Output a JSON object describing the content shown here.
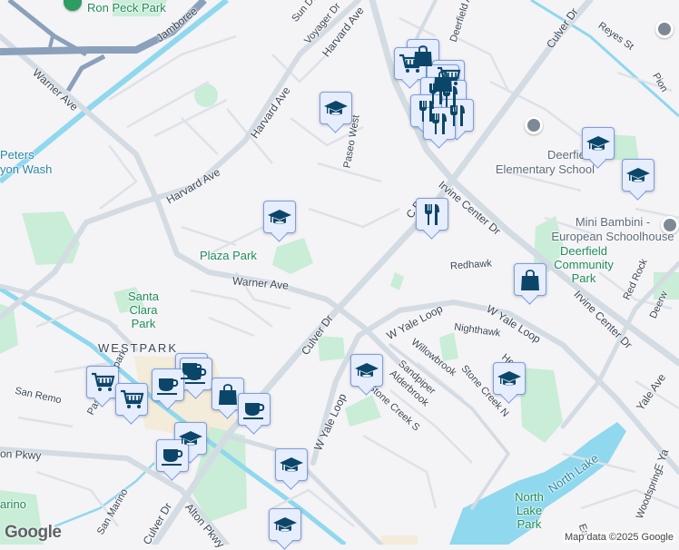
{
  "map": {
    "labels": {
      "ron_peck_park": "Ron Peck Park",
      "jamboree": "Jamboree",
      "sun_di": "Sun Di",
      "voyager_dr": "Voyager Dr",
      "harvard_ave_1": "Harvard Ave",
      "harvard_ave_2": "Harvard Ave",
      "harvard_ave_3": "Harvard Ave",
      "warner_ave_1": "Warner Ave",
      "warner_ave_2": "Warner Ave",
      "peters_canyon_wash_1": "Peters",
      "peters_canyon_wash_2": "yon Wash",
      "plaza_park": "Plaza Park",
      "paseo_west": "Paseo West",
      "deerfield_ave": "Deerfield Av",
      "culver_dr_1": "Culver Dr",
      "culver_dr_2": "C     Dr",
      "culver_dr_3": "Culver Dr",
      "culver_dr_4": "Culver Dr",
      "reyes_st": "Reyes St",
      "pion": "Pion",
      "deerfield_elementary": "Deerfield Elementary School",
      "irvine_center_dr_1": "Irvine Center Dr",
      "irvine_center_dr_2": "Irvine Center Dr",
      "mini_bambini": "Mini Bambini - European Schoolhouse",
      "deerfield_community_park": "Deerfield Community Park",
      "redhawk": "Redhawk",
      "red_rock": "Red Rock",
      "deerw": "Deerw",
      "santa_clara_park": "Santa Clara Park",
      "westpark": "WESTPARK",
      "san_remo": "San Remo",
      "paseo_westpark": "Paseo Westpark",
      "w_yale_loop_1": "W Yale Loop",
      "w_yale_loop_2": "W Yale Loop",
      "w_yale_loop_3": "W Yale Loop",
      "nighthawk": "Nighthawk",
      "willowbrook": "Willowbrook",
      "sandpiper": "Sandpiper",
      "alderbrook": "Alderbrook",
      "stone_creek_s": "Stone Creek S",
      "stone_creek_n": "Stone Creek N",
      "her": "Her",
      "yale_ave": "Yale Ave",
      "e_ya": "E Ya",
      "woodspring": "Woodspring",
      "north_lake": "North Lake",
      "north_lake_park": "North Lake Park",
      "san_marino_1": "San Marino",
      "san_marino_2": "arino",
      "alton_pkwy_1": "on Pkwy",
      "alton_pkwy_2": "Alton Pkwy",
      "ea": "Ea"
    },
    "attribution": "Map data ©2025 Google",
    "logo": "Google",
    "colors": {
      "background": "#f4f3f5",
      "road": "#d3dbe3",
      "freeway": "#8aa0bb",
      "water": "#8fd8ee",
      "park": "#c9edd7",
      "commercial": "#f3ecda",
      "marker_fill": "#e6edfc",
      "marker_icon": "#0b4669"
    }
  }
}
